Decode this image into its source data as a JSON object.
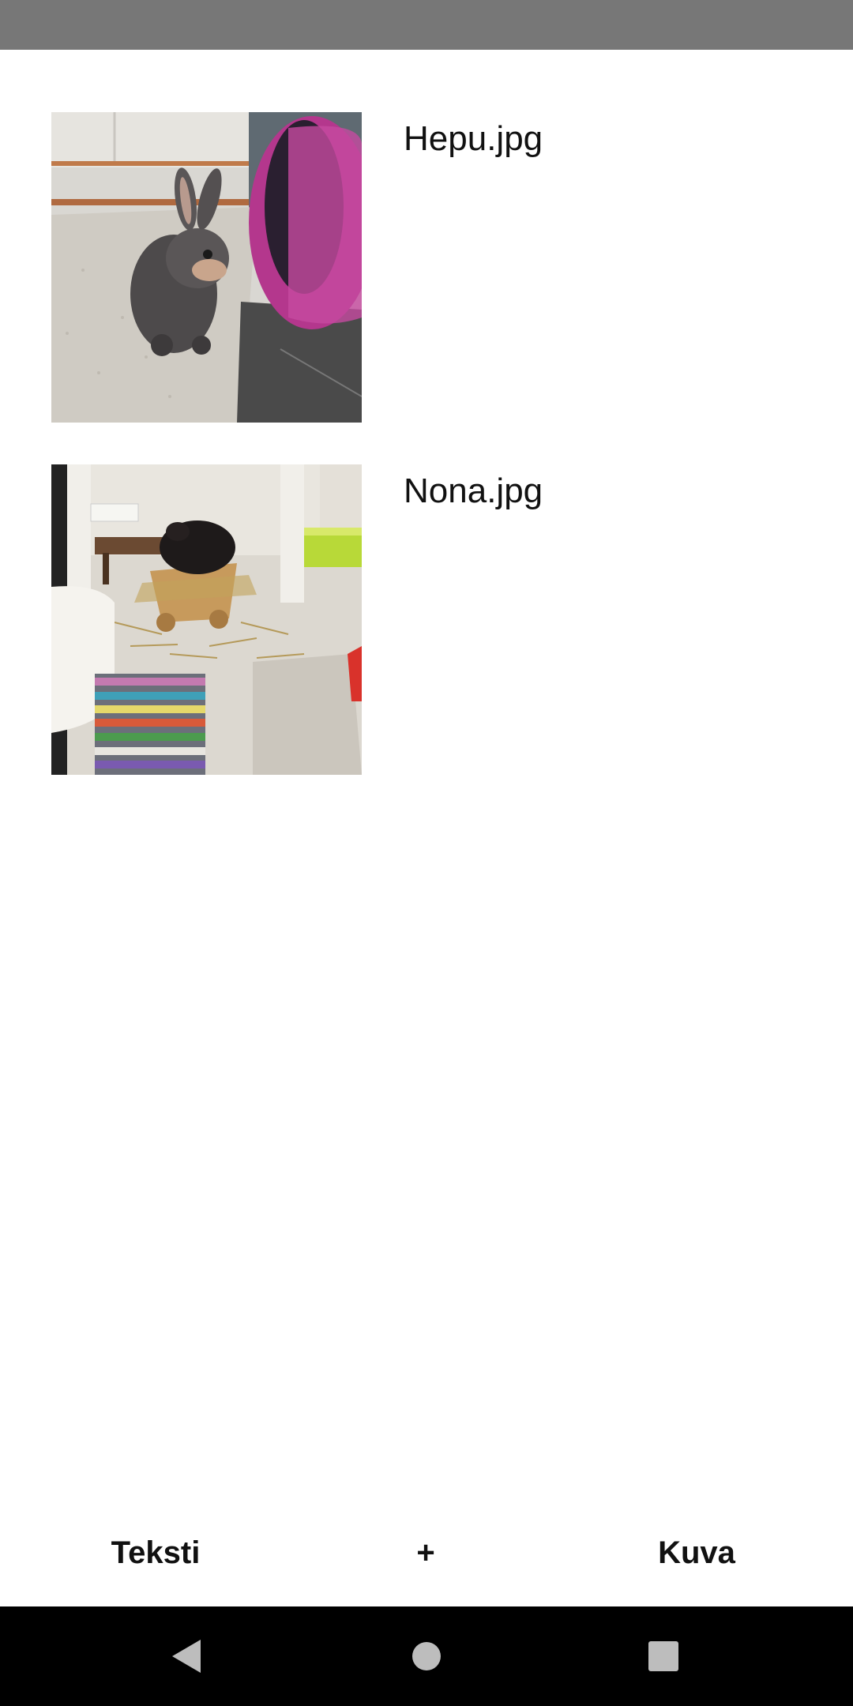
{
  "files": [
    {
      "name": "Hepu.jpg",
      "image": "photo of grey rabbit beside pink play tunnel"
    },
    {
      "name": "Nona.jpg",
      "image": "photo of black rabbit in small wooden hay cart"
    }
  ],
  "bottom_bar": {
    "text_label": "Teksti",
    "add_label": "+",
    "image_label": "Kuva"
  },
  "nav": {
    "back_icon": "triangle-back-icon",
    "home_icon": "circle-home-icon",
    "recent_icon": "square-recent-icon"
  },
  "colors": {
    "status_bar": "#777777",
    "nav_bar": "#000000",
    "background": "#ffffff",
    "nav_icon": "#bdbdbd"
  }
}
